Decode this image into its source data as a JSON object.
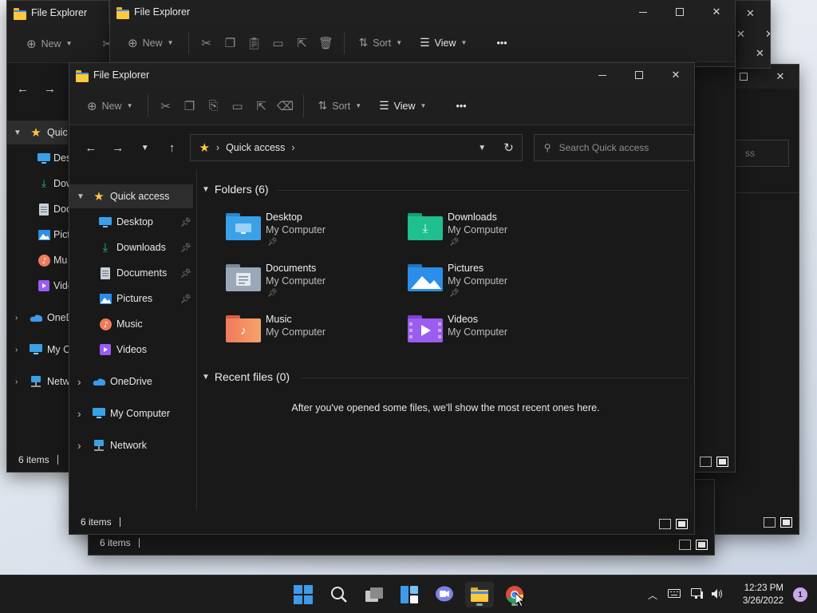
{
  "window": {
    "title": "File Explorer",
    "status_count": "6 items"
  },
  "toolbar": {
    "new_label": "New",
    "sort_label": "Sort",
    "view_label": "View",
    "more_label": "•••"
  },
  "address": {
    "location": "Quick access",
    "search_placeholder": "Search Quick access"
  },
  "sidebar": {
    "quick_access": "Quick access",
    "pinned": [
      {
        "label": "Desktop",
        "icon": "desktop-icon"
      },
      {
        "label": "Downloads",
        "icon": "download-icon"
      },
      {
        "label": "Documents",
        "icon": "document-icon"
      },
      {
        "label": "Pictures",
        "icon": "picture-icon"
      }
    ],
    "music": "Music",
    "videos": "Videos",
    "onedrive": "OneDrive",
    "my_computer": "My Computer",
    "network": "Network"
  },
  "bg_sidebar_partial": {
    "quick": "Quic",
    "desktop": "Desk",
    "downloads": "Dow",
    "documents": "Doc",
    "pictures": "Pict",
    "music": "Mu",
    "videos": "Vide",
    "onedrive": "OneD",
    "computer": "My C",
    "network": "Netw"
  },
  "folders": {
    "header": "Folders (6)",
    "items": [
      {
        "name": "Desktop",
        "location": "My Computer",
        "pinned": true,
        "color": "#3aa0e8"
      },
      {
        "name": "Downloads",
        "location": "My Computer",
        "pinned": true,
        "color": "#1fbf8f"
      },
      {
        "name": "Documents",
        "location": "My Computer",
        "pinned": true,
        "color": "#9aa8b8"
      },
      {
        "name": "Pictures",
        "location": "My Computer",
        "pinned": true,
        "color": "#2b8ee8"
      },
      {
        "name": "Music",
        "location": "My Computer",
        "pinned": false,
        "color": "#f07a5a"
      },
      {
        "name": "Videos",
        "location": "My Computer",
        "pinned": false,
        "color": "#9b5cf0"
      }
    ]
  },
  "recent": {
    "header": "Recent files (0)",
    "empty_message": "After you've opened some files, we'll show the most recent ones here."
  },
  "search_partial": "ss",
  "taskbar": {
    "time": "12:23 PM",
    "date": "3/26/2022",
    "notifications": "1"
  },
  "colors": {
    "window_bg": "#191919",
    "folder_yellow": "#ffc83d",
    "accent": "#3d8de6"
  }
}
